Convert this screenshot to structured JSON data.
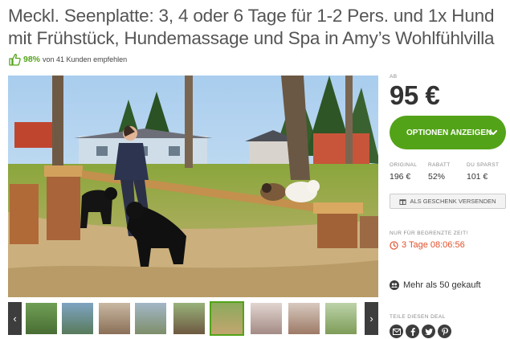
{
  "deal": {
    "title": "Meckl. Seenplatte: 3, 4 oder 6 Tage für 1-2 Pers. und 1x Hund mit Frühstück, Hundemassage und Spa in Amy’s Wohlfühlvilla",
    "rating_percent": "98%",
    "rating_text": "von 41 Kunden empfehlen"
  },
  "gallery": {
    "thumbnails": [
      "Bild 1",
      "Bild 2",
      "Bild 3",
      "Bild 4",
      "Bild 5",
      "Bild 6",
      "Bild 7",
      "Bild 8",
      "Bild 9",
      "Bild 10"
    ],
    "active_index": 5,
    "prev_label": "‹",
    "next_label": "›"
  },
  "sidebar": {
    "price_prefix": "AB",
    "price": "95 €",
    "options_button": "OPTIONEN ANZEIGEN",
    "stats": [
      {
        "label": "ORIGINAL",
        "value": "196 €"
      },
      {
        "label": "RABATT",
        "value": "52%"
      },
      {
        "label": "DU SPARST",
        "value": "101 €"
      }
    ],
    "gift_button": "ALS GESCHENK VERSENDEN",
    "limited_label": "NUR FÜR BEGRENZTE ZEIT!",
    "timer": "3 Tage 08:06:56",
    "sold": "Mehr als 50 gekauft",
    "share_label": "TEILE DIESEN DEAL",
    "social": [
      "email-icon",
      "facebook-icon",
      "twitter-icon",
      "pinterest-icon"
    ]
  },
  "colors": {
    "brand_green": "#53a318",
    "timer_orange": "#e0502b",
    "dark": "#3d3d3d"
  }
}
